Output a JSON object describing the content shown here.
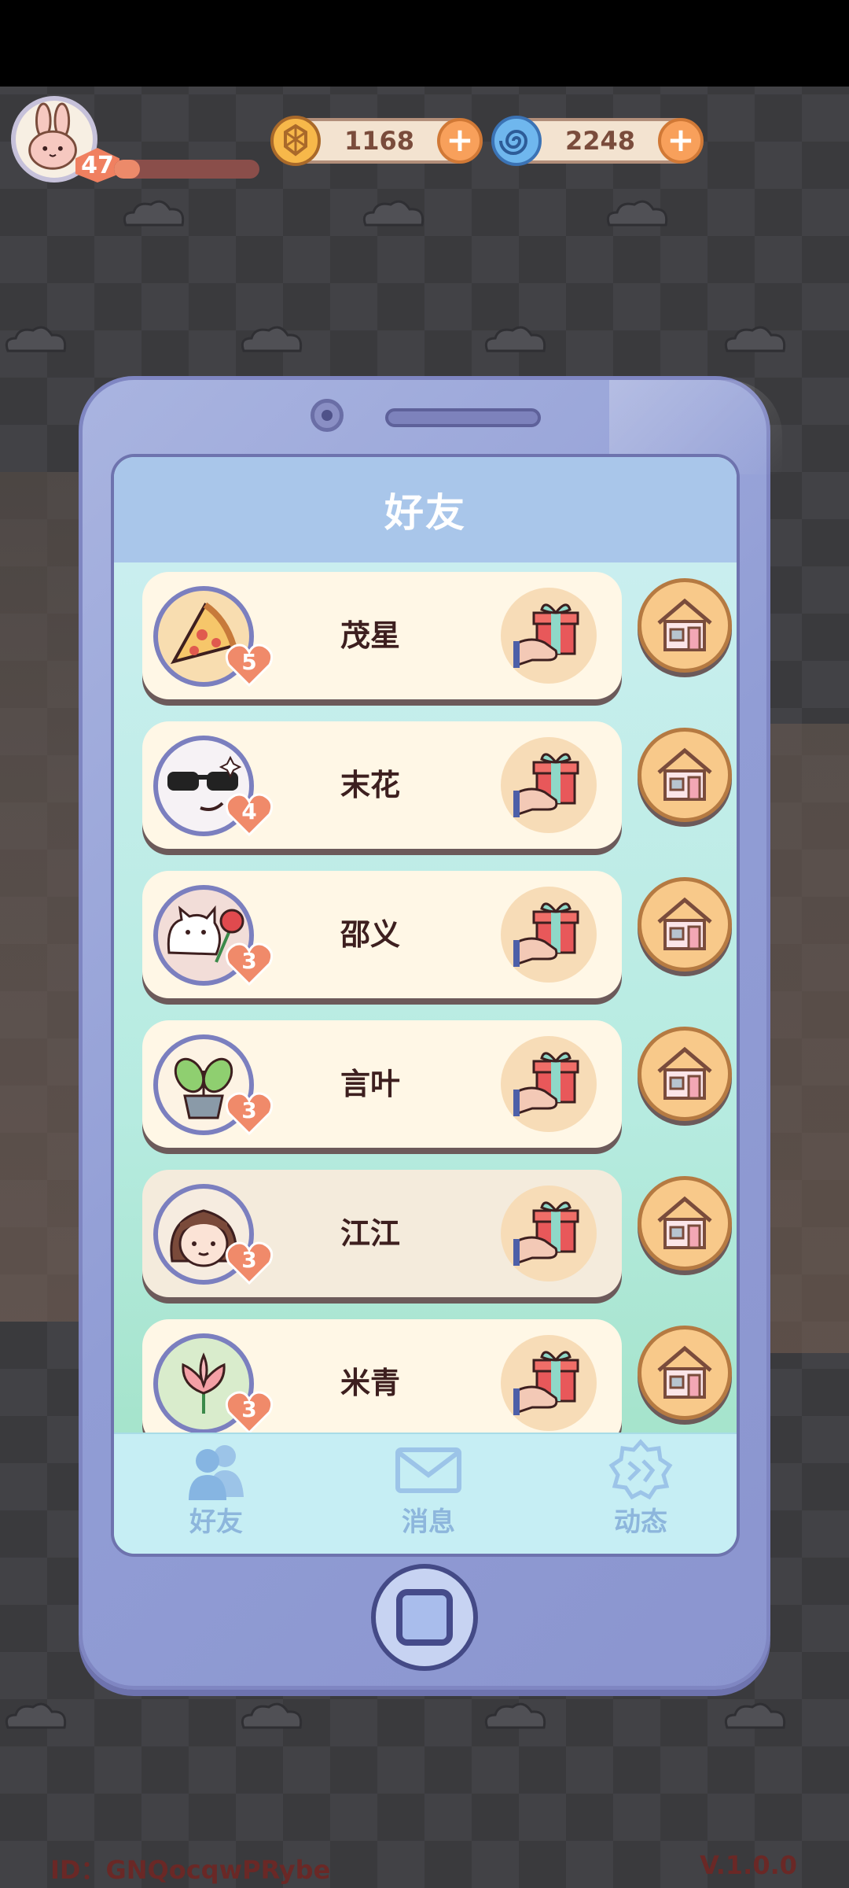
{
  "player": {
    "level": "47",
    "xp_progress": 0.18
  },
  "currencies": [
    {
      "name": "gold-coin",
      "value": "1168",
      "icon": "coin-icon"
    },
    {
      "name": "spiral-gem",
      "value": "2248",
      "icon": "swirl-icon"
    }
  ],
  "screen": {
    "title": "好友"
  },
  "friends": [
    {
      "name": "茂星",
      "hearts": "5",
      "avatar": "pizza-avatar"
    },
    {
      "name": "末花",
      "hearts": "4",
      "avatar": "sunglasses-avatar"
    },
    {
      "name": "邵义",
      "hearts": "3",
      "avatar": "cat-rose-avatar"
    },
    {
      "name": "言叶",
      "hearts": "3",
      "avatar": "plant-avatar"
    },
    {
      "name": "江江",
      "hearts": "3",
      "avatar": "girl-avatar"
    },
    {
      "name": "米青",
      "hearts": "3",
      "avatar": "lotus-avatar"
    }
  ],
  "tabs": [
    {
      "label": "好友",
      "icon": "friends-icon"
    },
    {
      "label": "消息",
      "icon": "mail-icon"
    },
    {
      "label": "动态",
      "icon": "feed-icon"
    }
  ],
  "footer": {
    "id_text": "ID：GNQocqwPRybe",
    "version": "V.1.0.0"
  },
  "colors": {
    "accent": "#f08060",
    "name_text": "#3d1f1f",
    "tab_text": "#8db6dc"
  }
}
